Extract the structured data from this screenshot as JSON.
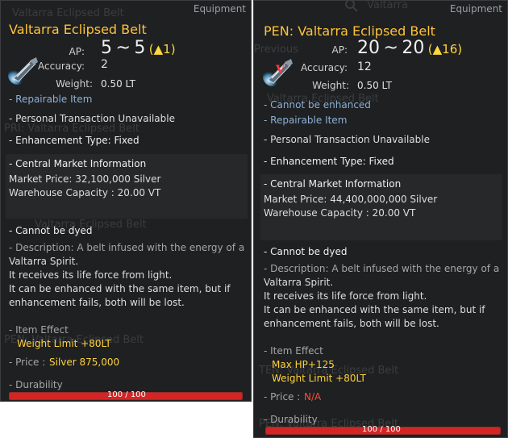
{
  "tooltips": [
    {
      "category": "Equipment",
      "title": "Valtarra Eclipsed Belt",
      "ap_label": "AP:",
      "ap_min": "5",
      "ap_tilde": "~",
      "ap_max": "5",
      "ap_diff": "(▲1)",
      "accuracy_label": "Accuracy:",
      "accuracy_value": "2",
      "weight_label": "Weight:",
      "weight_value": "0.50 LT",
      "status_lines": [
        "- Repairable Item"
      ],
      "transaction": "- Personal Transaction Unavailable",
      "enhancement_type": "- Enhancement Type: Fixed",
      "market_header": "- Central Market Information",
      "market_price": "Market Price: 32,100,000 Silver",
      "warehouse_capacity": "Warehouse Capacity : 20.00 VT",
      "dye": "- Cannot be dyed",
      "description": [
        "- Description: A belt infused with the energy of a",
        "Valtarra Spirit.",
        "It receives its life force from light.",
        "It can be enhanced with the same item, but if",
        "enhancement fails, both will be lost."
      ],
      "effect_header": "- Item Effect",
      "effects": [
        "Weight Limit +80LT"
      ],
      "price_label": "- Price :",
      "price_value": "Silver 875,000",
      "durability_label": "- Durability",
      "durability_text": "100 / 100",
      "durability_fraction": 1.0,
      "ghost": [
        "Valtarra Eclipsed Belt",
        "PRI: Valtarra Eclipsed Belt",
        "Valtarra Eclipsed Belt",
        "PEN: Valtarra Eclipsed Belt"
      ]
    },
    {
      "category": "Equipment",
      "title": "PEN: Valtarra Eclipsed Belt",
      "ap_label": "AP:",
      "ap_min": "20",
      "ap_tilde": "~",
      "ap_max": "20",
      "ap_diff": "(▲16)",
      "accuracy_label": "Accuracy:",
      "accuracy_value": "12",
      "weight_label": "Weight:",
      "weight_value": "0.50 LT",
      "status_lines": [
        "- Cannot be enhanced",
        "- Repairable Item"
      ],
      "transaction": "- Personal Transaction Unavailable",
      "enhancement_type": "- Enhancement Type: Fixed",
      "market_header": "- Central Market Information",
      "market_price": "Market Price: 44,400,000,000 Silver",
      "warehouse_capacity": "Warehouse Capacity : 20.00 VT",
      "dye": "- Cannot be dyed",
      "description": [
        "- Description: A belt infused with the energy of a",
        "Valtarra Spirit.",
        "It receives its life force from light.",
        "It can be enhanced with the same item, but if",
        "enhancement fails, both will be lost."
      ],
      "effect_header": "- Item Effect",
      "effects": [
        "Max HP+125",
        "Weight Limit +80LT"
      ],
      "price_label": "- Price :",
      "price_value": "N/A",
      "durability_label": "- Durability",
      "durability_text": "100 / 100",
      "durability_fraction": 1.0,
      "ghost": [
        "Valtarra",
        "Previous",
        "Valtarra Eclipsed Belt",
        "TEN: Valtarra Eclipsed Belt",
        "PEN: Valtarra Eclipsed Belt"
      ]
    }
  ],
  "colors": {
    "title": "#ffc23a",
    "ap_diff": "#ffd740",
    "effect": "#ffd23c",
    "price_na": "#ff4a3a",
    "repairable": "#8fb0d6",
    "durability_bar": "#d42525"
  },
  "icons": {
    "item": "belt-item-icon",
    "search": "search-icon"
  }
}
